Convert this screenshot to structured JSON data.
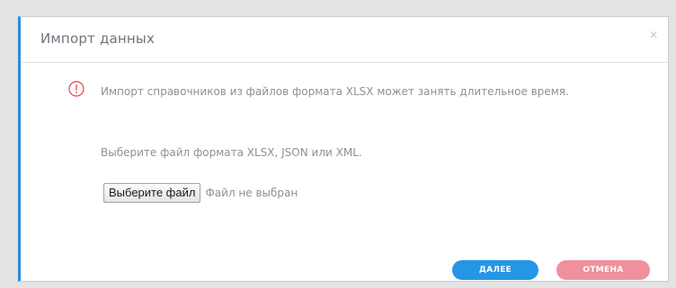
{
  "dialog": {
    "title": "Импорт данных",
    "close_glyph": "✕"
  },
  "warning": {
    "icon": "exclamation-circle-icon",
    "text": "Импорт справочников из файлов формата XLSX может занять длительное время."
  },
  "hint": "Выберите файл формата XLSX, JSON или XML.",
  "file_input": {
    "button_label": "Выберите файл",
    "status": "Файл не выбран"
  },
  "buttons": {
    "next_label": "ДАЛЕЕ",
    "cancel_label": "ОТМЕНА"
  },
  "colors": {
    "accent_blue": "#2596e6",
    "cancel_pink": "#f0909c",
    "warning_red": "#e0454f"
  }
}
